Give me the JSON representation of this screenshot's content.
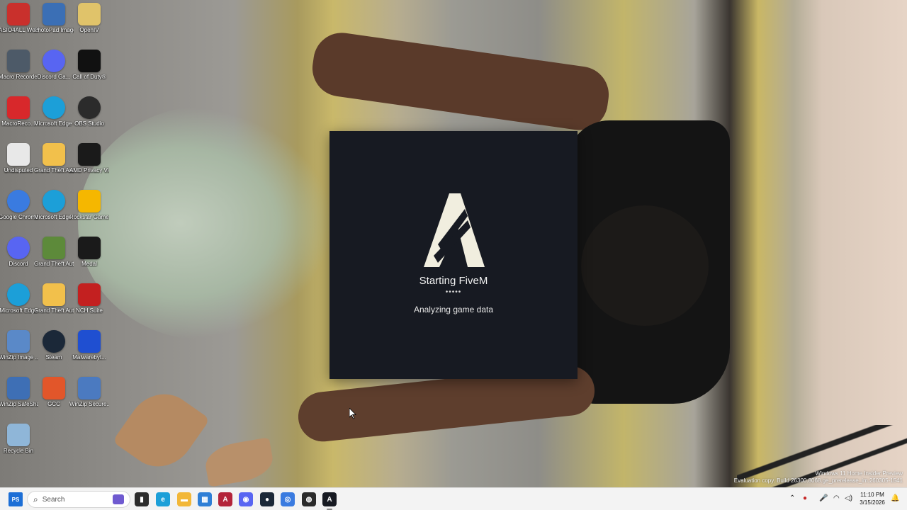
{
  "desktop": {
    "icons": [
      {
        "label": "ASIO4ALL Web Site",
        "icon": "asio-icon",
        "color": "#c9302c"
      },
      {
        "label": "PhotoPad Image Editor",
        "icon": "photopad-icon",
        "color": "#3b6fb5"
      },
      {
        "label": "OpenIV",
        "icon": "openiv-icon",
        "color": "#e0c36a"
      },
      {
        "label": "Macro Recorder",
        "icon": "macro-recorder-icon",
        "color": "#4d5a68"
      },
      {
        "label": "Discord Ga...",
        "icon": "discord-icon",
        "color": "#5865f2"
      },
      {
        "label": "Call of Duty®",
        "icon": "call-of-duty-icon",
        "color": "#111111"
      },
      {
        "label": "MacroReco...",
        "icon": "macrorecorder-icon",
        "color": "#d8282b"
      },
      {
        "label": "Microsoft Edge - BePa...",
        "icon": "edge-icon",
        "color": "#1c9fd8"
      },
      {
        "label": "OBS Studio",
        "icon": "obs-icon",
        "color": "#2b2b2b"
      },
      {
        "label": "Undisputed",
        "icon": "undisputed-icon",
        "color": "#e8e8e8"
      },
      {
        "label": "Grand Theft Auto V.zip",
        "icon": "zip-folder-icon",
        "color": "#f2c04b"
      },
      {
        "label": "AMD Privacy View",
        "icon": "amd-privacy-icon",
        "color": "#1a1a1a"
      },
      {
        "label": "Google Chrome",
        "icon": "chrome-icon",
        "color": "#3a7be0"
      },
      {
        "label": "Microsoft Edge - Copy",
        "icon": "edge-icon",
        "color": "#1c9fd8"
      },
      {
        "label": "Rockstar Games ...",
        "icon": "rockstar-icon",
        "color": "#f5b700"
      },
      {
        "label": "Discord",
        "icon": "discord-icon",
        "color": "#5865f2"
      },
      {
        "label": "Grand Theft Auto V",
        "icon": "gta-icon",
        "color": "#5d8a3a"
      },
      {
        "label": "Medal",
        "icon": "medal-icon",
        "color": "#1a1a1a"
      },
      {
        "label": "Microsoft Edge",
        "icon": "edge-icon",
        "color": "#1c9fd8"
      },
      {
        "label": "Grand Theft Auto V",
        "icon": "folder-icon",
        "color": "#f2c04b"
      },
      {
        "label": "NCH Suite",
        "icon": "nch-icon",
        "color": "#c32020"
      },
      {
        "label": "WinZip Image ...",
        "icon": "winzip-image-icon",
        "color": "#5a89c8"
      },
      {
        "label": "Steam",
        "icon": "steam-icon",
        "color": "#1b2838"
      },
      {
        "label": "Malwarebyt...",
        "icon": "malwarebytes-icon",
        "color": "#1f4fd1"
      },
      {
        "label": "WinZip SafeShare",
        "icon": "winzip-safeshare-icon",
        "color": "#3e6fb5"
      },
      {
        "label": "GCC",
        "icon": "gcc-icon",
        "color": "#e2562a"
      },
      {
        "label": "WinZip Secure...",
        "icon": "winzip-secure-icon",
        "color": "#4b7ac0"
      },
      {
        "label": "Recycle Bin",
        "icon": "recycle-bin-icon",
        "color": "#8fb6d8"
      }
    ]
  },
  "splash": {
    "title": "Starting FiveM",
    "dots": "•••••",
    "status": "Analyzing game data",
    "background": "#171a22",
    "logo_color": "#f1eedf"
  },
  "watermark": {
    "line1": "Windows 11 Home Insider Preview",
    "line2": "Evaluation copy. Build 26300.8068.ge_prerelease_im.260305-1541"
  },
  "taskbar": {
    "start_label": "PS",
    "search_placeholder": "Search",
    "apps": [
      {
        "name": "file-explorer-pinned",
        "icon": "terminal-icon",
        "color": "#2c2c2c",
        "glyph": "▮"
      },
      {
        "name": "edge",
        "icon": "edge-icon",
        "color": "#1c9fd8",
        "glyph": "e"
      },
      {
        "name": "file-explorer",
        "icon": "folder-icon",
        "color": "#f2b738",
        "glyph": "▬"
      },
      {
        "name": "microsoft-store",
        "icon": "store-icon",
        "color": "#2f7fd6",
        "glyph": "▦"
      },
      {
        "name": "fivem-red",
        "icon": "fivem-red-icon",
        "color": "#b3243a",
        "glyph": "A"
      },
      {
        "name": "discord",
        "icon": "discord-icon",
        "color": "#5865f2",
        "glyph": "◉"
      },
      {
        "name": "steam",
        "icon": "steam-icon",
        "color": "#1b2838",
        "glyph": "●"
      },
      {
        "name": "chrome",
        "icon": "chrome-icon",
        "color": "#3a7be0",
        "glyph": "◎"
      },
      {
        "name": "obs",
        "icon": "obs-icon",
        "color": "#2b2b2b",
        "glyph": "◍"
      },
      {
        "name": "fivem",
        "icon": "fivem-icon",
        "color": "#171a22",
        "glyph": "A"
      }
    ],
    "tray": {
      "time": "11:10 PM",
      "date": "3/15/2026"
    }
  }
}
